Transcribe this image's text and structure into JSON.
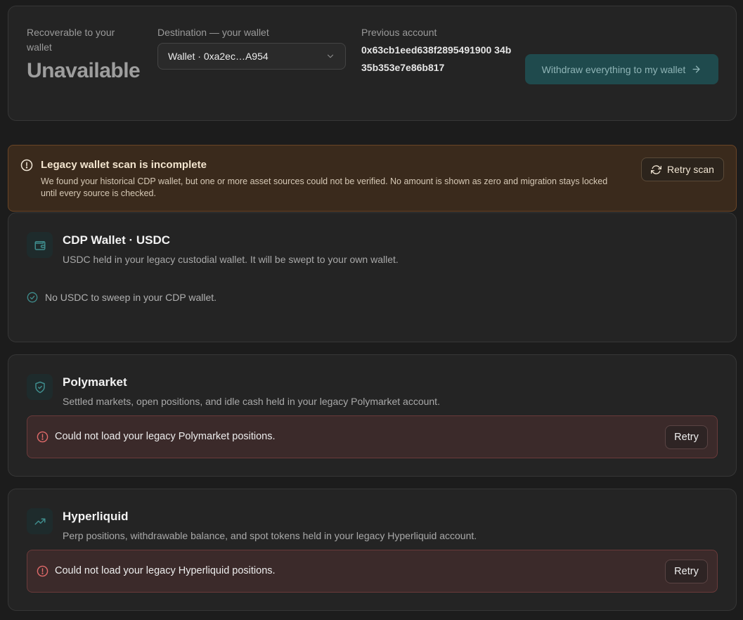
{
  "summary": {
    "recoverable_label": "Recoverable to your wallet",
    "recoverable_value": "Unavailable",
    "destination_label": "Destination — your wallet",
    "destination_value": "Wallet · 0xa2ec…A954",
    "previous_label": "Previous account",
    "previous_address": "0x63cb1eed638f2895491900 34b35b353e7e86b817",
    "withdraw_label": "Withdraw everything to my wallet"
  },
  "warning": {
    "title": "Legacy wallet scan is incomplete",
    "body": "We found your historical CDP wallet, but one or more asset sources could not be verified. No amount is shown as zero and migration stays locked until every source is checked.",
    "retry_label": "Retry scan"
  },
  "sources": {
    "cdp": {
      "title": "CDP Wallet · USDC",
      "description": "USDC held in your legacy custodial wallet. It will be swept to your own wallet.",
      "status": "No USDC to sweep in your CDP wallet."
    },
    "polymarket": {
      "title": "Polymarket",
      "description": "Settled markets, open positions, and idle cash held in your legacy Polymarket account.",
      "error": "Could not load your legacy Polymarket positions.",
      "retry_label": "Retry"
    },
    "hyperliquid": {
      "title": "Hyperliquid",
      "description": "Perp positions, withdrawable balance, and spot tokens held in your legacy Hyperliquid account.",
      "error": "Could not load your legacy Hyperliquid positions.",
      "retry_label": "Retry"
    }
  },
  "icons": {
    "select": "chevron-down-icon",
    "withdraw": "arrow-right-icon",
    "warning": "alert-circle-icon",
    "retry_scan": "refresh-icon",
    "cdp": "wallet-icon",
    "cdp_status": "check-circle-icon",
    "polymarket": "shield-check-icon",
    "hyperliquid": "trending-up-icon",
    "error": "alert-circle-icon"
  },
  "colors": {
    "accent": "#3f8d8d",
    "warning_bg": "#3a2a1c",
    "error_bg": "#3b2a2a",
    "error_icon": "#e06a6a"
  }
}
